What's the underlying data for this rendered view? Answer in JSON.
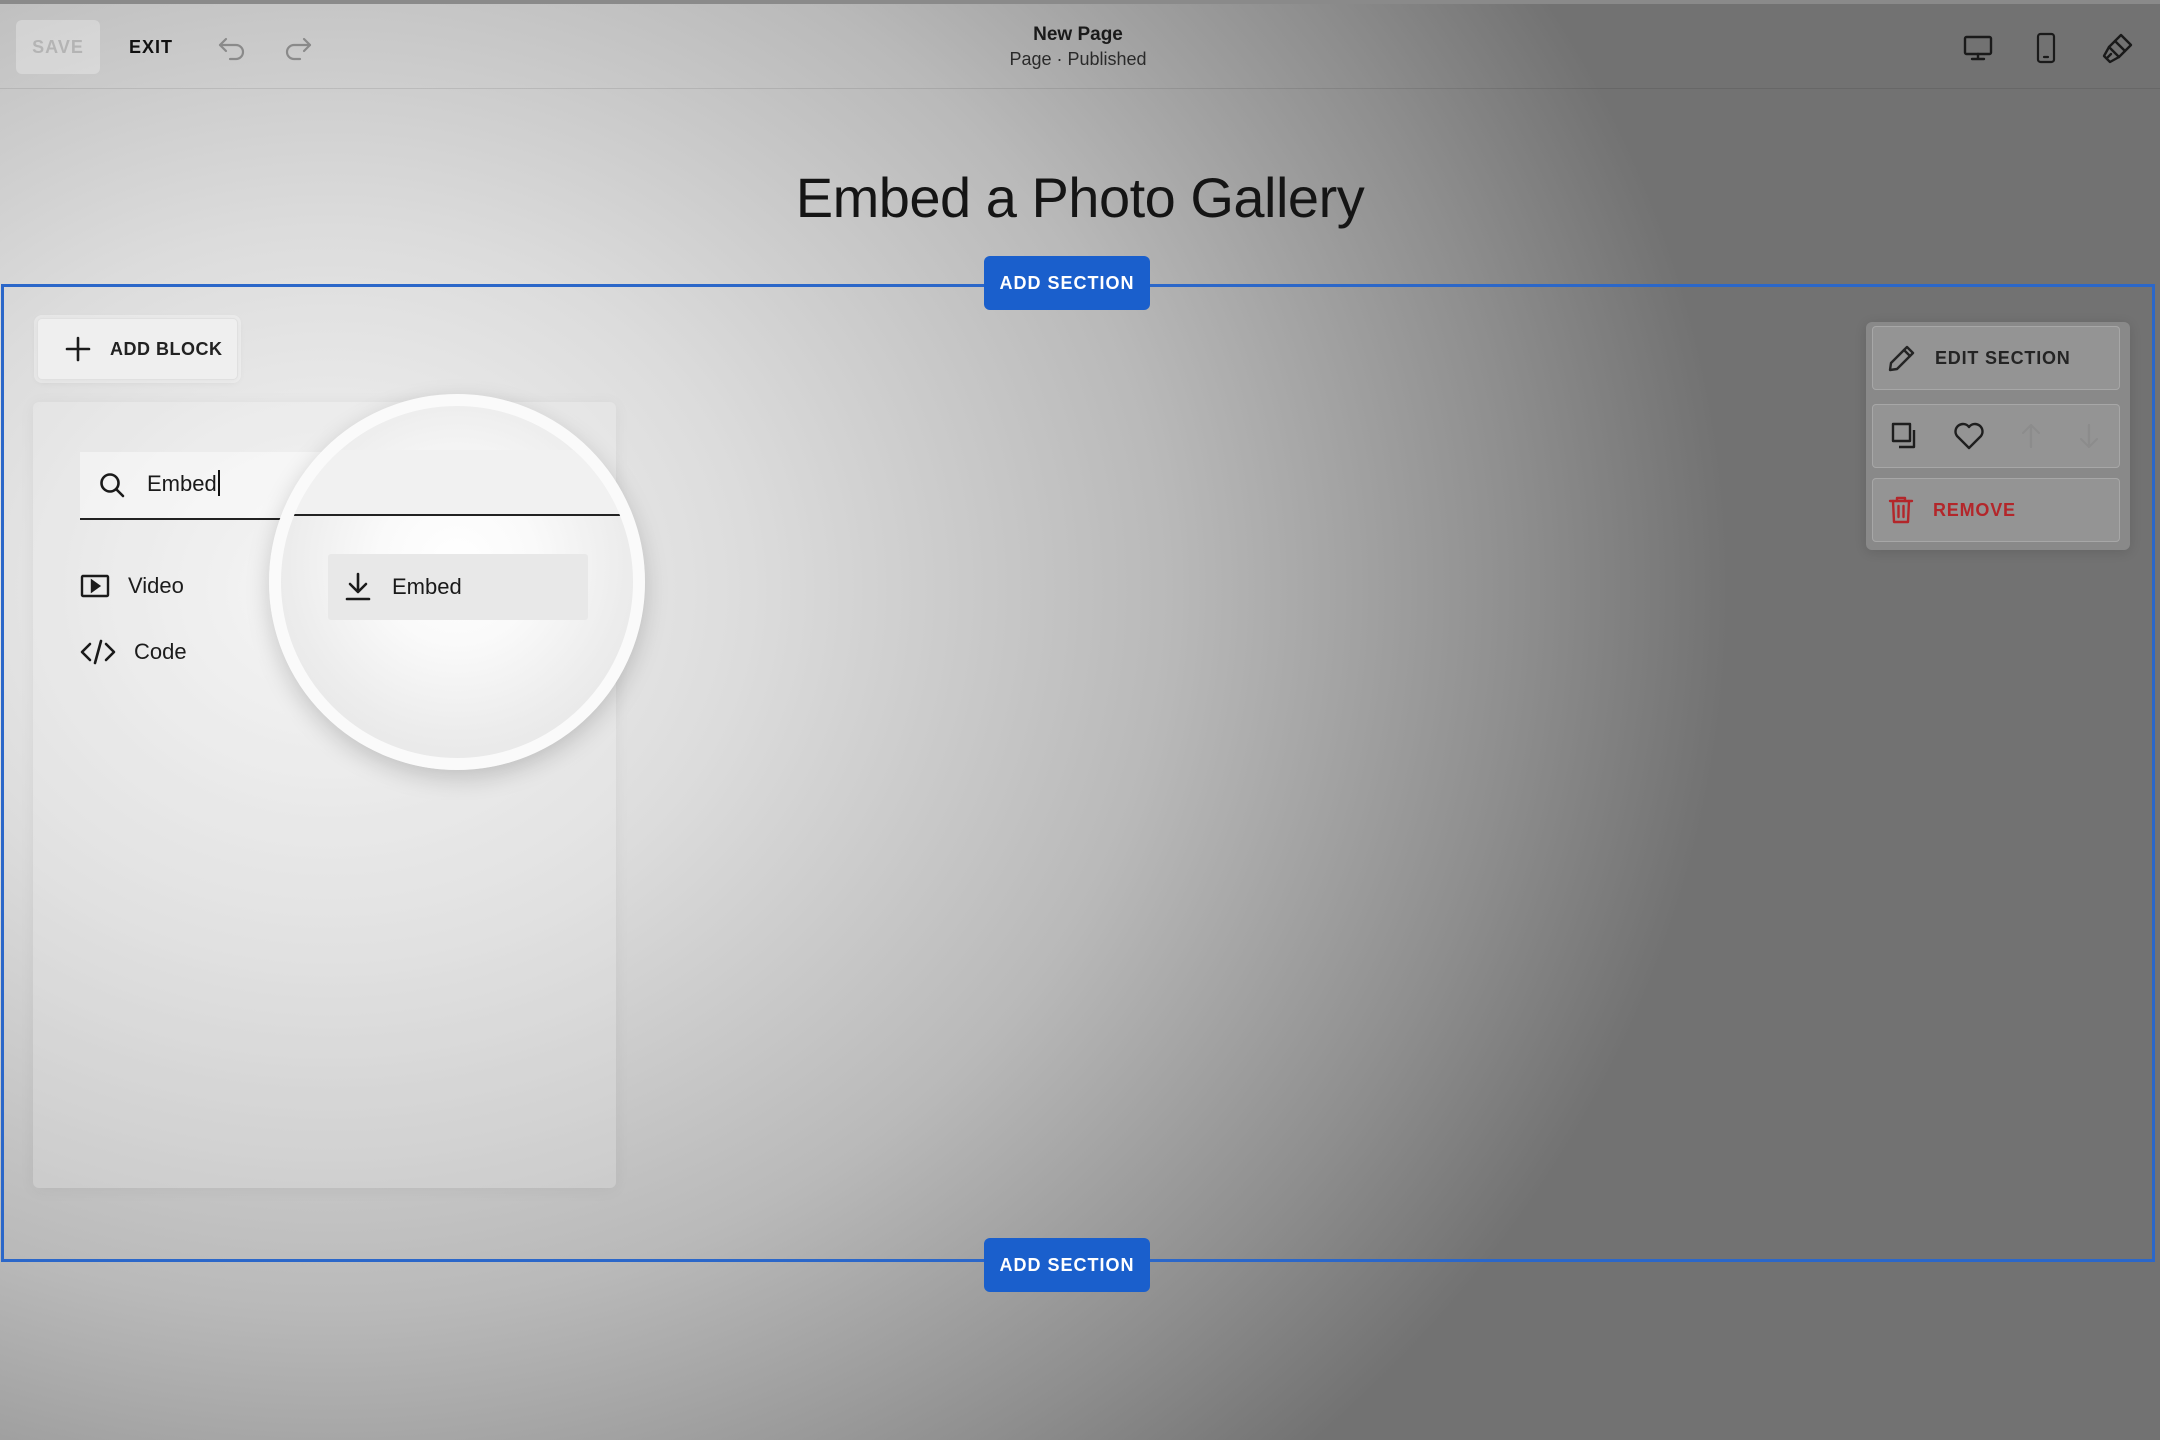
{
  "toolbar": {
    "save_label": "SAVE",
    "exit_label": "EXIT",
    "undo_icon": "undo-icon",
    "redo_icon": "redo-icon",
    "desktop_icon": "desktop-icon",
    "mobile_icon": "mobile-icon",
    "design_icon": "paintbrush-icon"
  },
  "page": {
    "name": "New Page",
    "status": "Page · Published",
    "title": "Embed a Photo Gallery"
  },
  "section": {
    "add_section_label": "ADD SECTION",
    "frame_color": "#2b67c9",
    "button_color": "#1a5fcc"
  },
  "add_block": {
    "label": "ADD BLOCK"
  },
  "search": {
    "value": "Embed"
  },
  "results": [
    {
      "label": "Video",
      "icon": "video-icon"
    },
    {
      "label": "Code",
      "icon": "code-icon"
    },
    {
      "label": "Embed",
      "icon": "download-icon"
    }
  ],
  "edit_panel": {
    "edit_label": "EDIT SECTION",
    "remove_label": "REMOVE",
    "remove_color": "#b3262a"
  }
}
